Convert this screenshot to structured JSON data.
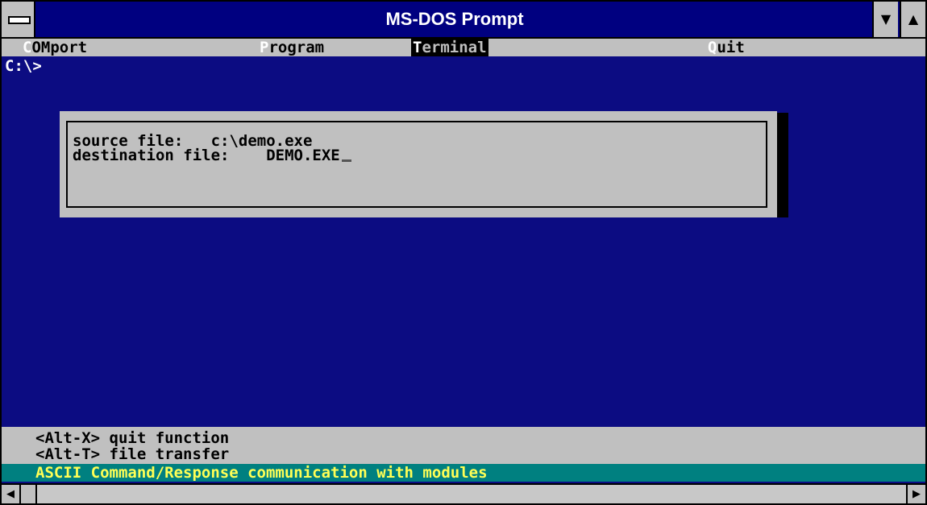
{
  "window": {
    "title": "MS-DOS Prompt",
    "system_menu_icon": "system-menu-icon",
    "minimize_icon": "minimize-icon",
    "maximize_icon": "maximize-icon"
  },
  "menubar": {
    "items": [
      {
        "hot": "C",
        "rest": "OMport",
        "active": false
      },
      {
        "hot": "P",
        "rest": "rogram",
        "active": false
      },
      {
        "hot": "T",
        "rest": "erminal",
        "active": true
      },
      {
        "hot": "Q",
        "rest": "uit",
        "active": false
      }
    ]
  },
  "console": {
    "prompt": "C:\\>"
  },
  "dialog": {
    "source_label": "source file:",
    "source_value": "c:\\demo.exe",
    "dest_label": "destination file:",
    "dest_value": "DEMO.EXE"
  },
  "help": {
    "line1": "<Alt-X> quit function",
    "line2": "<Alt-T> file transfer"
  },
  "status": {
    "text": "ASCII Command/Response communication with modules"
  },
  "scrollbar": {
    "left_icon": "scroll-left-icon",
    "right_icon": "scroll-right-icon"
  },
  "colors": {
    "console_bg": "#0c0c82",
    "menu_bg": "#c0c0c0",
    "status_bg": "#008080",
    "status_fg": "#ffff55"
  }
}
